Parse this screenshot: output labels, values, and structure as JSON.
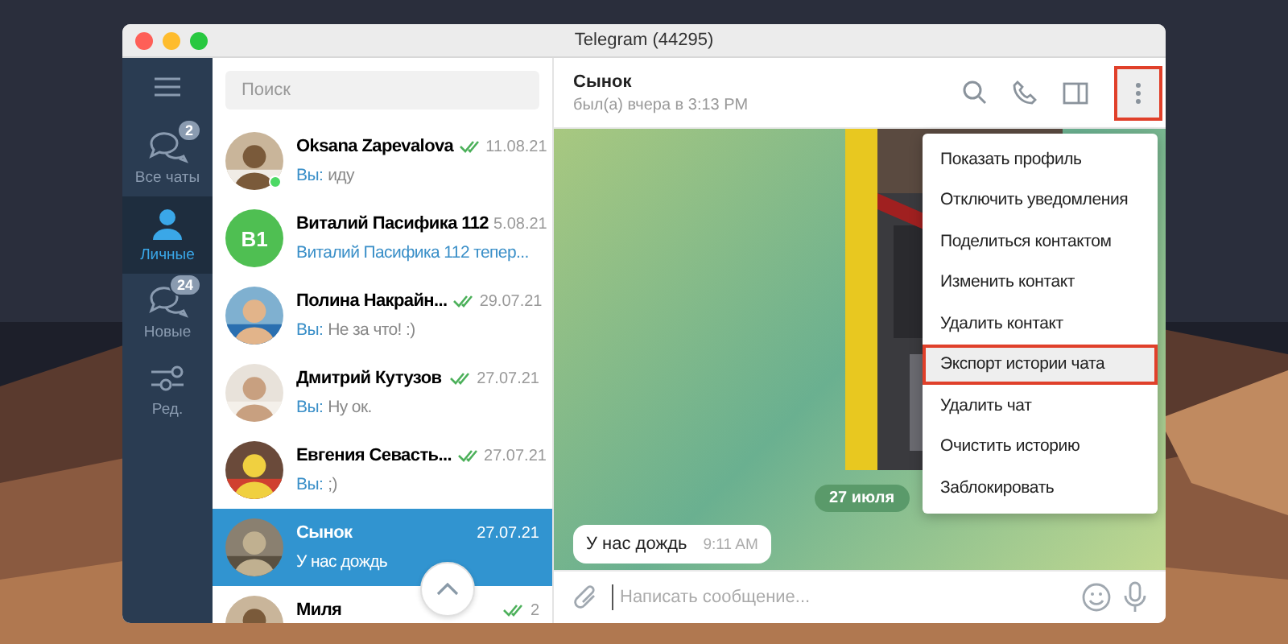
{
  "window": {
    "title": "Telegram (44295)"
  },
  "sidebar": {
    "items": [
      {
        "kind": "chats",
        "label": "Все чаты",
        "badge": "2",
        "selected": false
      },
      {
        "kind": "person",
        "label": "Личные",
        "selected": true
      },
      {
        "kind": "chats",
        "label": "Новые",
        "badge": "24",
        "selected": false
      },
      {
        "kind": "edit",
        "label": "Ред.",
        "selected": false
      }
    ]
  },
  "search": {
    "placeholder": "Поиск"
  },
  "chats": [
    {
      "name": "Oksana Zapevalova",
      "date": "11.08.21",
      "read": true,
      "sender": "Вы:",
      "preview": "иду",
      "online": true,
      "selected": false
    },
    {
      "avatar": {
        "kind": "initials",
        "initials": "B1",
        "color": "#4fbf52"
      },
      "name": "Виталий Пасифика 112",
      "date": "5.08.21",
      "read": false,
      "preview": "Виталий Пасифика 112 тепер...",
      "accent": true,
      "selected": false
    },
    {
      "name": "Полина Накрайн...",
      "date": "29.07.21",
      "read": true,
      "sender": "Вы:",
      "preview": "Не за что! :)",
      "selected": false
    },
    {
      "name": "Дмитрий Кутузов",
      "date": "27.07.21",
      "read": true,
      "sender": "Вы:",
      "preview": "Ну ок.",
      "selected": false
    },
    {
      "name": "Евгения Севасть...",
      "date": "27.07.21",
      "read": true,
      "sender": "Вы:",
      "preview": ";)",
      "selected": false
    },
    {
      "name": "Сынок",
      "date": "27.07.21",
      "read": false,
      "preview": "У нас дождь",
      "selected": true
    },
    {
      "name": "Миля",
      "date": "2",
      "read": true,
      "selected": false
    }
  ],
  "chat": {
    "name": "Сынок",
    "status": "был(а) вчера в 3:13 PM",
    "more_highlighted": true,
    "date_label": "27 июля",
    "messages": [
      {
        "text": "У нас дождь",
        "time": "9:11 AM"
      }
    ],
    "composer": {
      "placeholder": "Написать сообщение..."
    }
  },
  "menu": {
    "items": [
      {
        "label": "Показать профиль",
        "highlighted": false
      },
      {
        "label": "Отключить уведомления",
        "highlighted": false
      },
      {
        "label": "Поделиться контактом",
        "highlighted": false
      },
      {
        "label": "Изменить контакт",
        "highlighted": false
      },
      {
        "label": "Удалить контакт",
        "highlighted": false
      },
      {
        "label": "Экспорт истории чата",
        "highlighted": true
      },
      {
        "label": "Удалить чат",
        "highlighted": false
      },
      {
        "label": "Очистить историю",
        "highlighted": false
      },
      {
        "label": "Заблокировать",
        "highlighted": false
      }
    ]
  }
}
